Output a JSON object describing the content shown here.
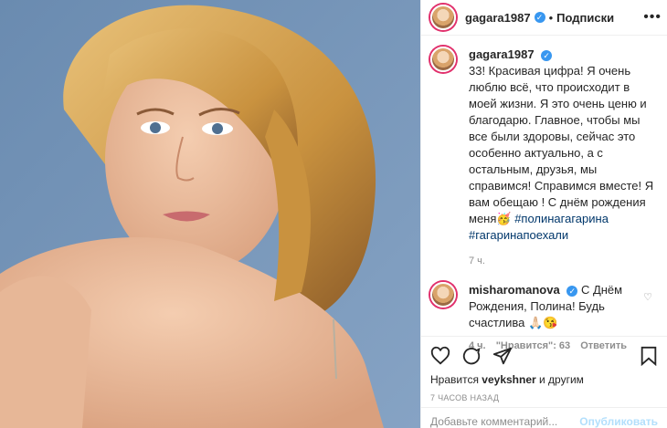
{
  "photo": {
    "alt": "portrait"
  },
  "header": {
    "username": "gagara1987",
    "follow_label": "Подписки",
    "more_label": "•••"
  },
  "caption": {
    "username": "gagara1987",
    "text": "33! Красивая цифра! Я очень люблю всё, что происходит в моей жизни. Я это очень ценю и благодарю. Главное, чтобы мы все были здоровы, сейчас это особенно актуально, а с остальным, друзья, мы справимся! Справимся вместе! Я вам обещаю ! С днём рождения меня🥳 ",
    "hashtag1": "#полинагагарина",
    "hashtag2": "#гагаринапоехали",
    "time": "7 ч."
  },
  "comment": {
    "username": "misharomanova",
    "text": "С Днём Рождения, Полина! Будь счастлива 🙏🏻😘",
    "time": "4 ч.",
    "likes": "\"Нравится\": 63",
    "reply": "Ответить"
  },
  "footer": {
    "likes_prefix": "Нравится",
    "likes_user": "veykshner",
    "likes_suffix": "и другим",
    "date": "7 ЧАСОВ НАЗАД",
    "add_comment_placeholder": "Добавьте комментарий...",
    "publish_label": "Опубликовать"
  },
  "colors": {
    "accent": "#3897f0",
    "link": "#00376b",
    "muted": "#8e8e8e"
  }
}
